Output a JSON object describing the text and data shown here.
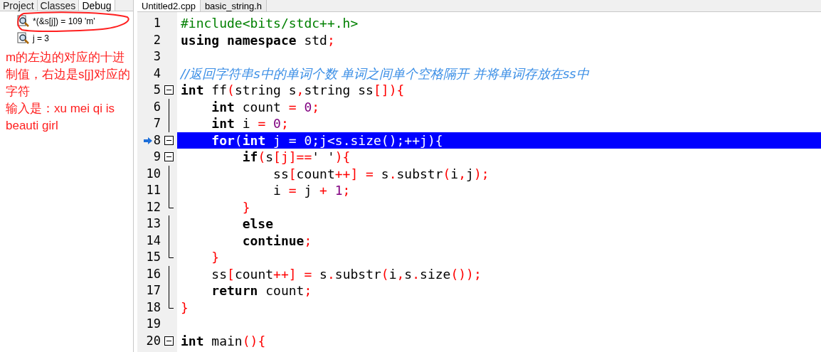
{
  "left_panel": {
    "tabs": [
      {
        "label": "Project",
        "selected": false
      },
      {
        "label": "Classes",
        "selected": false
      },
      {
        "label": "Debug",
        "selected": true
      }
    ],
    "watches": [
      {
        "text": "*(&s[j]) = 109 'm'"
      },
      {
        "text": "j = 3"
      }
    ]
  },
  "editor": {
    "tabs": [
      {
        "label": "Untitled2.cpp",
        "selected": true
      },
      {
        "label": "basic_string.h",
        "selected": false
      }
    ],
    "lines": [
      {
        "number": "1",
        "selected": false,
        "tokens": [
          {
            "kind": "pp",
            "text": "#include<bits/stdc++.h>"
          }
        ]
      },
      {
        "number": "2",
        "selected": false,
        "tokens": [
          {
            "kind": "kw",
            "text": "using"
          },
          {
            "kind": "kw",
            "text": " namespace"
          },
          {
            "kind": "id",
            "text": " std"
          },
          {
            "kind": "sym",
            "text": ";"
          }
        ]
      },
      {
        "number": "3",
        "selected": false
      },
      {
        "number": "4",
        "selected": false,
        "tokens": [
          {
            "kind": "cm",
            "text": "//返回字符串s中的单词个数 单词之间单个空格隔开 并将单词存放在ss中"
          }
        ]
      },
      {
        "number": "5",
        "expanded": true,
        "selected": false,
        "tokens": [
          {
            "kind": "kw",
            "text": "int"
          },
          {
            "kind": "id",
            "text": " ff"
          },
          {
            "kind": "sym",
            "text": "("
          },
          {
            "kind": "id",
            "text": "string s"
          },
          {
            "kind": "sym",
            "text": ","
          },
          {
            "kind": "id",
            "text": "string ss"
          },
          {
            "kind": "sym",
            "text": "[])"
          },
          {
            "kind": "sym",
            "text": "{"
          }
        ]
      },
      {
        "number": "6",
        "in_block": true,
        "selected": false,
        "tokens": [
          {
            "kind": "kw",
            "text": "    int"
          },
          {
            "kind": "id",
            "text": " count "
          },
          {
            "kind": "sym",
            "text": "="
          },
          {
            "kind": "num",
            "text": " 0"
          },
          {
            "kind": "sym",
            "text": ";"
          }
        ]
      },
      {
        "number": "7",
        "in_block": true,
        "selected": false,
        "tokens": [
          {
            "kind": "kw",
            "text": "    int"
          },
          {
            "kind": "id",
            "text": " i "
          },
          {
            "kind": "sym",
            "text": "="
          },
          {
            "kind": "num",
            "text": " 0"
          },
          {
            "kind": "sym",
            "text": ";"
          }
        ]
      },
      {
        "number": "8",
        "expanded": true,
        "selected": true,
        "current": true,
        "tokens": [
          {
            "kind": "kw",
            "text": "    for"
          },
          {
            "kind": "sym",
            "text": "("
          },
          {
            "kind": "kw",
            "text": "int"
          },
          {
            "kind": "id",
            "text": " j "
          },
          {
            "kind": "sym",
            "text": "="
          },
          {
            "kind": "num",
            "text": " 0"
          },
          {
            "kind": "sym",
            "text": ";"
          },
          {
            "kind": "id",
            "text": "j"
          },
          {
            "kind": "sym",
            "text": "<"
          },
          {
            "kind": "id",
            "text": "s"
          },
          {
            "kind": "sym",
            "text": "."
          },
          {
            "kind": "id",
            "text": "size"
          },
          {
            "kind": "sym",
            "text": "();++"
          },
          {
            "kind": "id",
            "text": "j"
          },
          {
            "kind": "sym",
            "text": "){"
          }
        ]
      },
      {
        "number": "9",
        "expanded": true,
        "selected": false,
        "tokens": [
          {
            "kind": "kw",
            "text": "        if"
          },
          {
            "kind": "sym",
            "text": "("
          },
          {
            "kind": "id",
            "text": "s"
          },
          {
            "kind": "sym",
            "text": "[j]=="
          },
          {
            "kind": "id",
            "text": "' '"
          },
          {
            "kind": "sym",
            "text": "){"
          }
        ]
      },
      {
        "number": "10",
        "in_block": true,
        "selected": false,
        "tokens": [
          {
            "kind": "id",
            "text": "            ss"
          },
          {
            "kind": "sym",
            "text": "["
          },
          {
            "kind": "id",
            "text": "count"
          },
          {
            "kind": "sym",
            "text": "++]"
          },
          {
            "kind": "sym",
            "text": " ="
          },
          {
            "kind": "id",
            "text": " s"
          },
          {
            "kind": "sym",
            "text": "."
          },
          {
            "kind": "id",
            "text": "substr"
          },
          {
            "kind": "sym",
            "text": "("
          },
          {
            "kind": "id",
            "text": "i"
          },
          {
            "kind": "sym",
            "text": ","
          },
          {
            "kind": "id",
            "text": "j"
          },
          {
            "kind": "sym",
            "text": ");"
          }
        ]
      },
      {
        "number": "11",
        "in_block": true,
        "selected": false,
        "tokens": [
          {
            "kind": "id",
            "text": "            i "
          },
          {
            "kind": "sym",
            "text": "="
          },
          {
            "kind": "id",
            "text": " j "
          },
          {
            "kind": "sym",
            "text": "+"
          },
          {
            "kind": "num",
            "text": " 1"
          },
          {
            "kind": "sym",
            "text": ";"
          }
        ]
      },
      {
        "number": "12",
        "block_end": true,
        "selected": false,
        "tokens": [
          {
            "kind": "sym",
            "text": "        }"
          }
        ]
      },
      {
        "number": "13",
        "in_block": true,
        "selected": false,
        "tokens": [
          {
            "kind": "kw",
            "text": "        else"
          }
        ]
      },
      {
        "number": "14",
        "in_block": true,
        "selected": false,
        "tokens": [
          {
            "kind": "kw",
            "text": "        continue"
          },
          {
            "kind": "sym",
            "text": ";"
          }
        ]
      },
      {
        "number": "15",
        "block_end": true,
        "selected": false,
        "tokens": [
          {
            "kind": "sym",
            "text": "    }"
          }
        ]
      },
      {
        "number": "16",
        "in_block": true,
        "selected": false,
        "tokens": [
          {
            "kind": "id",
            "text": "    ss"
          },
          {
            "kind": "sym",
            "text": "["
          },
          {
            "kind": "id",
            "text": "count"
          },
          {
            "kind": "sym",
            "text": "++]"
          },
          {
            "kind": "sym",
            "text": " ="
          },
          {
            "kind": "id",
            "text": " s"
          },
          {
            "kind": "sym",
            "text": "."
          },
          {
            "kind": "id",
            "text": "substr"
          },
          {
            "kind": "sym",
            "text": "("
          },
          {
            "kind": "id",
            "text": "i"
          },
          {
            "kind": "sym",
            "text": ","
          },
          {
            "kind": "id",
            "text": "s"
          },
          {
            "kind": "sym",
            "text": "."
          },
          {
            "kind": "id",
            "text": "size"
          },
          {
            "kind": "sym",
            "text": "());"
          }
        ]
      },
      {
        "number": "17",
        "in_block": true,
        "selected": false,
        "tokens": [
          {
            "kind": "kw",
            "text": "    return"
          },
          {
            "kind": "id",
            "text": " count"
          },
          {
            "kind": "sym",
            "text": ";"
          }
        ]
      },
      {
        "number": "18",
        "block_end": true,
        "selected": false,
        "tokens": [
          {
            "kind": "sym",
            "text": "}"
          }
        ]
      },
      {
        "number": "19",
        "selected": false
      },
      {
        "number": "20",
        "expanded": true,
        "selected": false,
        "tokens": [
          {
            "kind": "kw",
            "text": "int"
          },
          {
            "kind": "id",
            "text": " main"
          },
          {
            "kind": "sym",
            "text": "(){"
          }
        ]
      }
    ]
  },
  "annotations": [
    "m的左边的对应的十进制值，右边是s[j]对应的字符",
    "输入是：xu mei qi is beauti girl"
  ]
}
